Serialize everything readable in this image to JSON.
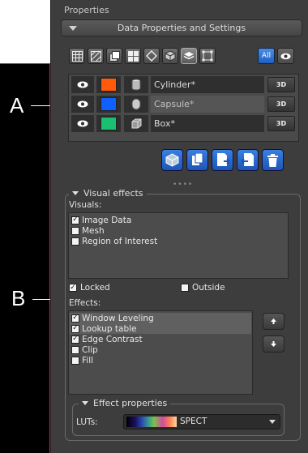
{
  "panel": {
    "title": "Properties",
    "header": "Data Properties and Settings"
  },
  "toolbar": {
    "buttons": [
      "grid-icon",
      "hatch-icon",
      "layers-icon",
      "tiles-icon",
      "diamond-icon",
      "cube-icon",
      "stack-icon",
      "bounding-box-icon"
    ],
    "all_label": "All"
  },
  "data_rows": [
    {
      "name": "Cylinder*",
      "color": "#ff5a0a",
      "btn": "3D",
      "selected": false
    },
    {
      "name": "Capsule*",
      "color": "#1060ff",
      "btn": "3D",
      "selected": true
    },
    {
      "name": "Box*",
      "color": "#18c070",
      "btn": "3D",
      "selected": false
    }
  ],
  "actions": [
    "cube-icon",
    "copy-icon",
    "import-icon",
    "export-icon",
    "trash-icon"
  ],
  "visual_effects": {
    "title": "Visual effects",
    "visuals_label": "Visuals:",
    "visuals": [
      {
        "label": "Image Data",
        "checked": true
      },
      {
        "label": "Mesh",
        "checked": false
      },
      {
        "label": "Region of Interest",
        "checked": false
      }
    ],
    "locked_label": "Locked",
    "locked_checked": true,
    "outside_label": "Outside",
    "outside_checked": false,
    "effects_label": "Effects:",
    "effects": [
      {
        "label": "Window Leveling",
        "checked": true,
        "selected": true
      },
      {
        "label": "Lookup table",
        "checked": true,
        "selected": true
      },
      {
        "label": "Edge Contrast",
        "checked": true,
        "selected": false
      },
      {
        "label": "Clip",
        "checked": false,
        "selected": false
      },
      {
        "label": "Fill",
        "checked": false,
        "selected": false
      }
    ]
  },
  "effect_properties": {
    "title": "Effect properties",
    "lut_label": "LUTs:",
    "lut_value": "SPECT"
  },
  "callouts": {
    "a": "A",
    "b": "B"
  }
}
